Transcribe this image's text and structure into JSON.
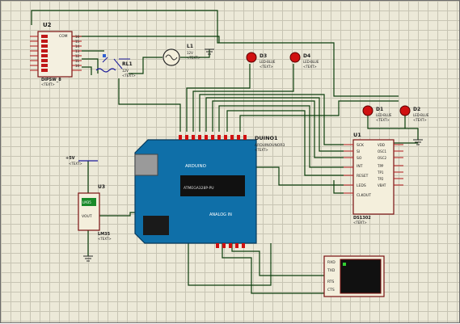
{
  "components": {
    "u2": {
      "ref": "U2",
      "part": "DIPSW_8",
      "pins_right": [
        "COM",
        "16",
        "15",
        "14",
        "13",
        "12",
        "11",
        "10"
      ]
    },
    "rl1": {
      "ref": "RL1",
      "value": "12V"
    },
    "l1": {
      "ref": "L1",
      "value": "12V"
    },
    "d3": {
      "ref": "D3",
      "part": "LED-BLUE"
    },
    "d4": {
      "ref": "D4",
      "part": "LED-BLUE"
    },
    "d1": {
      "ref": "D1",
      "part": "LED-BLUE"
    },
    "d2": {
      "ref": "D2",
      "part": "LED-BLUE"
    },
    "duino": {
      "ref": "DUINO1",
      "part": "ARDUINOUNOR3",
      "brand": "ARDUINO",
      "chip_text": "ATMEGA328P-PU",
      "analog_label": "ANALOG IN"
    },
    "u1": {
      "ref": "U1",
      "part": "DS1302",
      "pins_left": [
        "SCK",
        "SI",
        "SO",
        "INT",
        "RESET",
        "LEDS",
        "CLKOUT"
      ],
      "pins_right": [
        "VDD",
        "OSC1",
        "OSC2",
        "TPP",
        "TP1",
        "TP2",
        "VBAT"
      ]
    },
    "u3": {
      "ref": "U3",
      "sensor": "LM35",
      "vout": "VOUT",
      "part": "LM35"
    },
    "terminal": {
      "pins": [
        "RXD",
        "TXD",
        "RTS",
        "CTS"
      ]
    },
    "power": {
      "label": "+5V"
    }
  },
  "text_placeholder": "<TEXT>",
  "colors": {
    "wire": "#0b3d0b",
    "board": "#0f6fa8",
    "led": "#d01010",
    "grid_bg": "#ece9d8"
  }
}
